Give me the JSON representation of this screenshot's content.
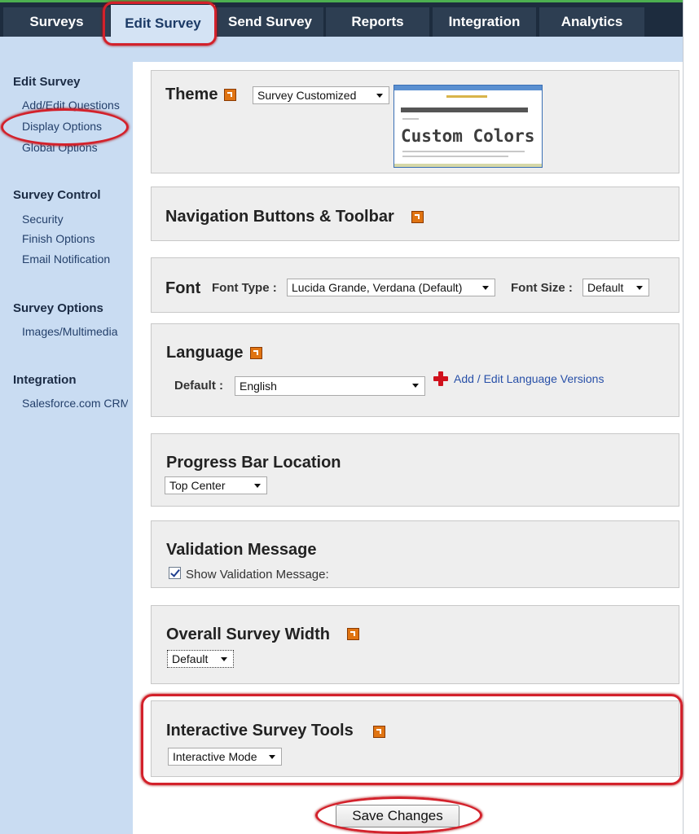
{
  "nav": {
    "tabs": [
      {
        "label": "Surveys"
      },
      {
        "label": "Edit Survey"
      },
      {
        "label": "Send Survey"
      },
      {
        "label": "Reports"
      },
      {
        "label": "Integration"
      },
      {
        "label": "Analytics"
      }
    ],
    "active_tab": "Edit Survey"
  },
  "sidebar": {
    "sections": [
      {
        "heading": "Edit Survey",
        "items": [
          "Add/Edit Questions",
          "Display Options",
          "Global Options"
        ]
      },
      {
        "heading": "Survey Control",
        "items": [
          "Security",
          "Finish Options",
          "Email Notification"
        ]
      },
      {
        "heading": "Survey Options",
        "items": [
          "Images/Multimedia"
        ]
      },
      {
        "heading": "Integration",
        "items": [
          "Salesforce.com CRM"
        ]
      }
    ]
  },
  "theme": {
    "title": "Theme",
    "selected": "Survey Customized",
    "preview_text": "Custom Colors"
  },
  "navigation": {
    "title": "Navigation Buttons & Toolbar"
  },
  "font": {
    "title": "Font",
    "type_label": "Font Type :",
    "type_value": "Lucida Grande, Verdana (Default)",
    "size_label": "Font Size :",
    "size_value": "Default"
  },
  "language": {
    "title": "Language",
    "default_label": "Default :",
    "default_value": "English",
    "add_link": "Add / Edit Language Versions"
  },
  "progress": {
    "title": "Progress Bar Location",
    "value": "Top Center"
  },
  "validation": {
    "title": "Validation Message",
    "checkbox_label": "Show Validation Message:",
    "checked": true
  },
  "width": {
    "title": "Overall Survey Width",
    "value": "Default"
  },
  "interactive": {
    "title": "Interactive Survey Tools",
    "value": "Interactive Mode"
  },
  "save_label": "Save Changes",
  "colors": {
    "highlight": "#d3212b",
    "nav_dark": "#1d2c3e",
    "sidebar_bg": "#c9dcf2",
    "help_icon": "#e07412"
  }
}
